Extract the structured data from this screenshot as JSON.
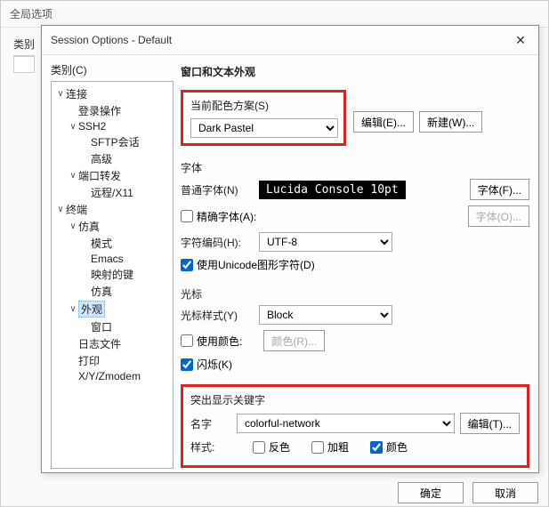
{
  "parent": {
    "title": "全局选项",
    "categoryLabel": "类别"
  },
  "dialog": {
    "title": "Session Options - Default",
    "categoryLabel": "类别(C)"
  },
  "tree": {
    "items": [
      {
        "label": "连接",
        "indent": 0,
        "tw": "∨"
      },
      {
        "label": "登录操作",
        "indent": 1,
        "tw": ""
      },
      {
        "label": "SSH2",
        "indent": 1,
        "tw": "∨"
      },
      {
        "label": "SFTP会话",
        "indent": 2,
        "tw": ""
      },
      {
        "label": "高级",
        "indent": 2,
        "tw": ""
      },
      {
        "label": "端口转发",
        "indent": 1,
        "tw": "∨"
      },
      {
        "label": "远程/X11",
        "indent": 2,
        "tw": ""
      },
      {
        "label": "终端",
        "indent": 0,
        "tw": "∨"
      },
      {
        "label": "仿真",
        "indent": 1,
        "tw": "∨"
      },
      {
        "label": "模式",
        "indent": 2,
        "tw": ""
      },
      {
        "label": "Emacs",
        "indent": 2,
        "tw": ""
      },
      {
        "label": "映射的键",
        "indent": 2,
        "tw": ""
      },
      {
        "label": "仿真",
        "indent": 2,
        "tw": ""
      },
      {
        "label": "外观",
        "indent": 1,
        "tw": "∨",
        "selected": true
      },
      {
        "label": "窗口",
        "indent": 2,
        "tw": ""
      },
      {
        "label": "日志文件",
        "indent": 1,
        "tw": ""
      },
      {
        "label": "打印",
        "indent": 1,
        "tw": ""
      },
      {
        "label": "X/Y/Zmodem",
        "indent": 1,
        "tw": ""
      }
    ]
  },
  "content": {
    "pageTitle": "窗口和文本外观",
    "scheme": {
      "label": "当前配色方案(S)",
      "value": "Dark Pastel",
      "editBtn": "编辑(E)...",
      "newBtn": "新建(W)..."
    },
    "font": {
      "header": "字体",
      "normalLabel": "普通字体(N)",
      "sample": "Lucida Console 10pt",
      "fontBtn": "字体(F)...",
      "preciseLabel": "精确字体(A):",
      "preciseBtn": "字体(O)...",
      "encodingLabel": "字符编码(H):",
      "encodingValue": "UTF-8",
      "unicodeLabel": "使用Unicode图形字符(D)"
    },
    "cursor": {
      "header": "光标",
      "styleLabel": "光标样式(Y)",
      "styleValue": "Block",
      "useColorLabel": "使用颜色:",
      "colorBtn": "颜色(R)...",
      "blinkLabel": "闪烁(K)"
    },
    "highlight": {
      "header": "突出显示关键字",
      "nameLabel": "名字",
      "nameValue": "colorful-network",
      "editBtn": "编辑(T)...",
      "styleLabel": "样式:",
      "reverseLabel": "反色",
      "boldLabel": "加粗",
      "colorLabel": "颜色"
    }
  },
  "buttons": {
    "ok": "确定",
    "cancel": "取消"
  }
}
